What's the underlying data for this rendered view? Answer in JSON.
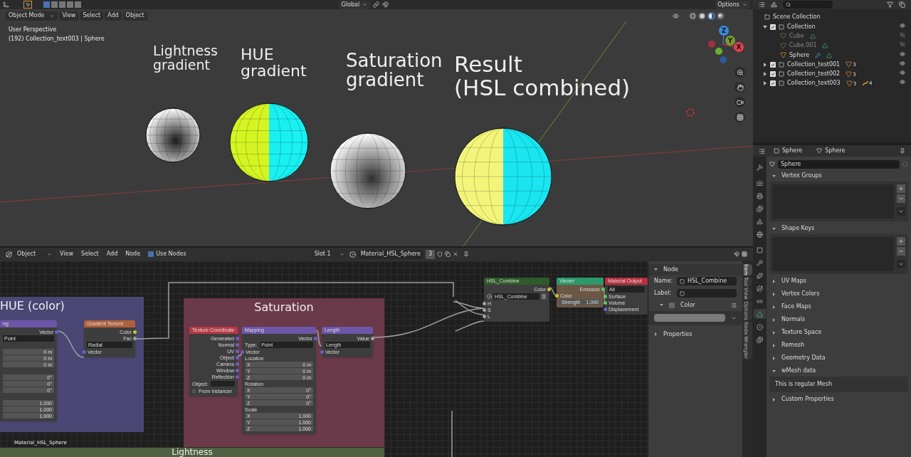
{
  "viewport": {
    "orientation": "Global",
    "options": "Options",
    "mode": "Object Mode",
    "menus": [
      "View",
      "Select",
      "Add",
      "Object"
    ],
    "overlay_info": [
      "User Perspective",
      "(192) Collection_text003 | Sphere"
    ],
    "shading_modes": [
      {
        "kind": "wireframe",
        "selected": false
      },
      {
        "kind": "solid",
        "selected": false
      },
      {
        "kind": "material",
        "selected": true
      },
      {
        "kind": "rendered",
        "selected": false
      }
    ],
    "objects": [
      {
        "label": "Lightness\ngradient",
        "kind": "lightness"
      },
      {
        "label": "HUE\ngradient",
        "kind": "hue"
      },
      {
        "label": "Saturation\ngradient",
        "kind": "saturation"
      },
      {
        "label": "Result\n(HSL combined)",
        "kind": "result"
      }
    ],
    "gizmo_axes": [
      "Z",
      "Y",
      "X"
    ]
  },
  "outliner": {
    "root": "Scene Collection",
    "items": [
      {
        "name": "Collection",
        "kind": "collection",
        "checked": true,
        "expanded": true,
        "visible": true,
        "children": [
          {
            "name": "Cube",
            "kind": "mesh",
            "hidden": true,
            "icons": [
              {
                "kind": "mesh-data"
              }
            ]
          },
          {
            "name": "Cube.001",
            "kind": "mesh",
            "hidden": true,
            "icons": [
              {
                "kind": "mesh-data"
              }
            ]
          },
          {
            "name": "Sphere",
            "kind": "mesh",
            "hidden": false,
            "icons": [
              {
                "kind": "modifier"
              },
              {
                "kind": "mesh-data"
              }
            ]
          }
        ]
      },
      {
        "name": "Collection_test001",
        "kind": "collection",
        "checked": true,
        "expanded": false,
        "visible": true,
        "badges": [
          {
            "kind": "mesh",
            "count": "3"
          }
        ]
      },
      {
        "name": "Collection_test002",
        "kind": "collection",
        "checked": true,
        "expanded": false,
        "visible": true,
        "badges": [
          {
            "kind": "mesh",
            "count": "3"
          }
        ]
      },
      {
        "name": "Collection_text003",
        "kind": "collection",
        "checked": true,
        "expanded": false,
        "visible": true,
        "badges": [
          {
            "kind": "mesh",
            "count": "3"
          },
          {
            "kind": "curve",
            "count": "4"
          }
        ]
      }
    ]
  },
  "properties": {
    "object": "Sphere",
    "data": "Sphere",
    "mesh_name": "Sphere",
    "tabs": [
      {
        "kind": "tool",
        "selected": false
      },
      {
        "kind": "render",
        "selected": false
      },
      {
        "kind": "output",
        "selected": false
      },
      {
        "kind": "view_layer",
        "selected": false
      },
      {
        "kind": "scene",
        "selected": false
      },
      {
        "kind": "world",
        "selected": false
      },
      {
        "kind": "object",
        "selected": false
      },
      {
        "kind": "modifiers",
        "selected": false
      },
      {
        "kind": "particles",
        "selected": false
      },
      {
        "kind": "physics",
        "selected": false
      },
      {
        "kind": "constraints",
        "selected": false
      },
      {
        "kind": "data",
        "selected": true
      },
      {
        "kind": "material",
        "selected": false
      },
      {
        "kind": "texture",
        "selected": false
      }
    ],
    "panels": [
      {
        "title": "Vertex Groups",
        "kind": "list",
        "expanded": true
      },
      {
        "title": "Shape Keys",
        "kind": "list",
        "expanded": true
      },
      {
        "title": "UV Maps",
        "expanded": false
      },
      {
        "title": "Vertex Colors",
        "expanded": false
      },
      {
        "title": "Face Maps",
        "expanded": false
      },
      {
        "title": "Normals",
        "expanded": false
      },
      {
        "title": "Texture Space",
        "expanded": false
      },
      {
        "title": "Remesh",
        "expanded": false
      },
      {
        "title": "Geometry Data",
        "expanded": false
      },
      {
        "title": "wMesh data",
        "kind": "text",
        "expanded": true,
        "text": "This is regular Mesh"
      },
      {
        "title": "Custom Properties",
        "expanded": false
      }
    ]
  },
  "node_editor": {
    "object": "Object",
    "menus": [
      "View",
      "Select",
      "Add",
      "Node"
    ],
    "use_nodes": {
      "label": "Use Nodes",
      "checked": true
    },
    "slot": "Slot 1",
    "material": "Material_HSL_Sphere",
    "users": "3",
    "frames": [
      {
        "label": "HUE (color)",
        "color": "#4a4775"
      },
      {
        "label": "Saturation",
        "color": "#6b3a4a"
      },
      {
        "label": "Lightness",
        "color": "#4f6140"
      }
    ],
    "tree_name": "Material_HSL_Sphere",
    "nodes": [
      {
        "title": "ng",
        "color": "#6c56a8",
        "rows": [
          {
            "kind": "out",
            "label": "Vector",
            "color": "#6363c7"
          },
          {
            "kind": "dropdown",
            "value": "Point"
          },
          {
            "kind": "heading",
            "label": ""
          },
          {
            "kind": "field",
            "label": "",
            "value": "0 m"
          },
          {
            "kind": "field",
            "label": "",
            "value": "0 m"
          },
          {
            "kind": "field",
            "label": "",
            "value": "0 m"
          },
          {
            "kind": "heading",
            "label": ""
          },
          {
            "kind": "field",
            "label": "",
            "value": "0°"
          },
          {
            "kind": "field",
            "label": "",
            "value": "0°"
          },
          {
            "kind": "field",
            "label": "",
            "value": "0°"
          },
          {
            "kind": "heading",
            "label": ""
          },
          {
            "kind": "field",
            "label": "",
            "value": "1.000"
          },
          {
            "kind": "field",
            "label": "",
            "value": "1.000"
          },
          {
            "kind": "field",
            "label": "",
            "value": "1.000"
          }
        ]
      },
      {
        "title": "Gradient Texture",
        "color": "#b0603a",
        "rows": [
          {
            "kind": "out",
            "label": "Color",
            "color": "#c7c729"
          },
          {
            "kind": "out",
            "label": "Fac",
            "color": "#a1a1a1"
          },
          {
            "kind": "dropdown",
            "value": "Radial"
          },
          {
            "kind": "in",
            "label": "Vector",
            "color": "#6363c7"
          }
        ]
      },
      {
        "title": "Texture Coordinate",
        "color": "#b83a45",
        "rows": [
          {
            "kind": "out",
            "label": "Generated",
            "color": "#6363c7"
          },
          {
            "kind": "out",
            "label": "Normal",
            "color": "#6363c7"
          },
          {
            "kind": "out",
            "label": "UV",
            "color": "#6363c7"
          },
          {
            "kind": "out",
            "label": "Object",
            "color": "#6363c7"
          },
          {
            "kind": "out",
            "label": "Camera",
            "color": "#6363c7"
          },
          {
            "kind": "out",
            "label": "Window",
            "color": "#6363c7"
          },
          {
            "kind": "out",
            "label": "Reflection",
            "color": "#6363c7"
          },
          {
            "kind": "object",
            "label": "Object:"
          },
          {
            "kind": "check",
            "label": "From Instancer",
            "checked": false
          }
        ]
      },
      {
        "title": "Mapping",
        "color": "#6c56a8",
        "rows": [
          {
            "kind": "out",
            "label": "Vector",
            "color": "#6363c7"
          },
          {
            "kind": "dropdown",
            "label": "Type:",
            "value": "Point"
          },
          {
            "kind": "in",
            "label": "Vector",
            "color": "#6363c7"
          },
          {
            "kind": "heading",
            "label": "Location"
          },
          {
            "kind": "field",
            "label": "X",
            "value": "0 m"
          },
          {
            "kind": "field",
            "label": "Y",
            "value": "0 m"
          },
          {
            "kind": "field",
            "label": "Z",
            "value": "0 m"
          },
          {
            "kind": "heading",
            "label": "Rotation"
          },
          {
            "kind": "field",
            "label": "X",
            "value": "0°"
          },
          {
            "kind": "field",
            "label": "Y",
            "value": "0°"
          },
          {
            "kind": "field",
            "label": "Z",
            "value": "0°"
          },
          {
            "kind": "heading",
            "label": "Scale"
          },
          {
            "kind": "field",
            "label": "X",
            "value": "1.000"
          },
          {
            "kind": "field",
            "label": "Y",
            "value": "1.000"
          },
          {
            "kind": "field",
            "label": "Z",
            "value": "1.000"
          }
        ]
      },
      {
        "title": "Length",
        "color": "#6c56a8",
        "rows": [
          {
            "kind": "out",
            "label": "Value",
            "color": "#a1a1a1"
          },
          {
            "kind": "dropdown",
            "value": "Length"
          },
          {
            "kind": "in",
            "label": "Vector",
            "color": "#6363c7"
          }
        ]
      },
      {
        "title": "HSL_Combine",
        "color": "#2f5a2a",
        "rows": [
          {
            "kind": "out",
            "label": "Color",
            "color": "#c7c729"
          },
          {
            "kind": "group",
            "value": "HSL_Combine",
            "users": "3"
          },
          {
            "kind": "in",
            "label": "H",
            "color": "#a1a1a1"
          },
          {
            "kind": "in",
            "label": "S",
            "color": "#a1a1a1"
          },
          {
            "kind": "in",
            "label": "L",
            "color": "#a1a1a1"
          }
        ]
      },
      {
        "title": "Viewer",
        "color": "#2a9a6a",
        "body": {
          "color": "#6b5744"
        },
        "rows": [
          {
            "kind": "out",
            "label": "Emission",
            "color": "#63c763"
          },
          {
            "kind": "in",
            "label": "Color",
            "color": "#c7c729"
          },
          {
            "kind": "field",
            "label": "Strength",
            "value": "1.000"
          }
        ]
      },
      {
        "title": "Material Output",
        "color": "#b8303e",
        "rows": [
          {
            "kind": "dropdown",
            "value": "All"
          },
          {
            "kind": "in",
            "label": "Surface",
            "color": "#63c763"
          },
          {
            "kind": "in",
            "label": "Volume",
            "color": "#63c763"
          },
          {
            "kind": "in",
            "label": "Displacement",
            "color": "#6363c7"
          }
        ]
      }
    ],
    "sidebar": {
      "section": "Node",
      "name_label": "Name:",
      "name": "HSL_Combine",
      "label_label": "Label:",
      "color": {
        "label": "Color",
        "checked": false
      },
      "properties": "Properties",
      "tabs": [
        {
          "label": "Item",
          "selected": true
        },
        {
          "label": "Tool",
          "selected": false
        },
        {
          "label": "View",
          "selected": false
        },
        {
          "label": "Options",
          "selected": false
        },
        {
          "label": "Node Wrangler",
          "selected": false
        }
      ]
    }
  }
}
